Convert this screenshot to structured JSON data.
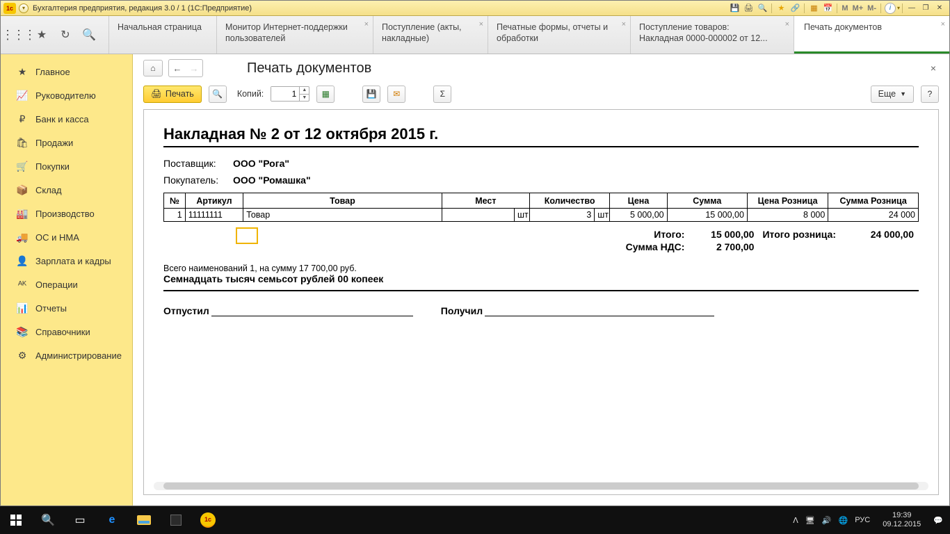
{
  "titlebar": {
    "title": "Бухгалтерия предприятия, редакция 3.0 / 1  (1С:Предприятие)",
    "mem": {
      "m": "M",
      "mplus": "M+",
      "mminus": "M-"
    }
  },
  "tabs": {
    "t0": "Начальная страница",
    "t1a": "Монитор Интернет-поддержки",
    "t1b": "пользователей",
    "t2a": "Поступление (акты,",
    "t2b": "накладные)",
    "t3a": "Печатные формы, отчеты и",
    "t3b": "обработки",
    "t4a": "Поступление товаров:",
    "t4b": "Накладная 0000-000002 от 12...",
    "t5": "Печать документов"
  },
  "sidebar": [
    {
      "icon": "★",
      "label": "Главное"
    },
    {
      "icon": "📈",
      "label": "Руководителю"
    },
    {
      "icon": "₽",
      "label": "Банк и касса"
    },
    {
      "icon": "🛍",
      "label": "Продажи"
    },
    {
      "icon": "🛒",
      "label": "Покупки"
    },
    {
      "icon": "📦",
      "label": "Склад"
    },
    {
      "icon": "🏭",
      "label": "Производство"
    },
    {
      "icon": "🚚",
      "label": "ОС и НМА"
    },
    {
      "icon": "👤",
      "label": "Зарплата и кадры"
    },
    {
      "icon": "ᴬᴷ",
      "label": "Операции"
    },
    {
      "icon": "📊",
      "label": "Отчеты"
    },
    {
      "icon": "📚",
      "label": "Справочники"
    },
    {
      "icon": "⚙",
      "label": "Администрирование"
    }
  ],
  "page": {
    "title": "Печать документов"
  },
  "toolbar": {
    "print": "Печать",
    "copies_label": "Копий:",
    "copies_value": "1",
    "more": "Еще",
    "help": "?"
  },
  "doc": {
    "title": "Накладная № 2 от 12 октября 2015 г.",
    "supplier_label": "Поставщик:",
    "supplier": "ООО \"Рога\"",
    "buyer_label": "Покупатель:",
    "buyer": "ООО \"Ромашка\"",
    "headers": {
      "n": "№",
      "art": "Артикул",
      "prod": "Товар",
      "mest": "Мест",
      "qty": "Количество",
      "price": "Цена",
      "sum": "Сумма",
      "rprice": "Цена Розница",
      "rsum": "Сумма Розница"
    },
    "rows": [
      {
        "n": "1",
        "art": "11111111",
        "prod": "Товар",
        "mest": "",
        "unit": "шт",
        "qty": "3",
        "unit2": "шт",
        "price": "5 000,00",
        "sum": "15 000,00",
        "rprice": "8 000",
        "rsum": "24 000"
      }
    ],
    "totals": {
      "itogo_label": "Итого:",
      "itogo": "15 000,00",
      "roz_label": "Итого розница:",
      "roz": "24 000,00",
      "nds_label": "Сумма НДС:",
      "nds": "2 700,00"
    },
    "summary_line": "Всего наименований 1, на сумму 17 700,00 руб.",
    "summary_words": "Семнадцать тысяч семьсот рублей 00 копеек",
    "sig1": "Отпустил",
    "sig2": "Получил"
  },
  "taskbar": {
    "time": "19:39",
    "date": "09.12.2015",
    "lang": "РУС"
  }
}
